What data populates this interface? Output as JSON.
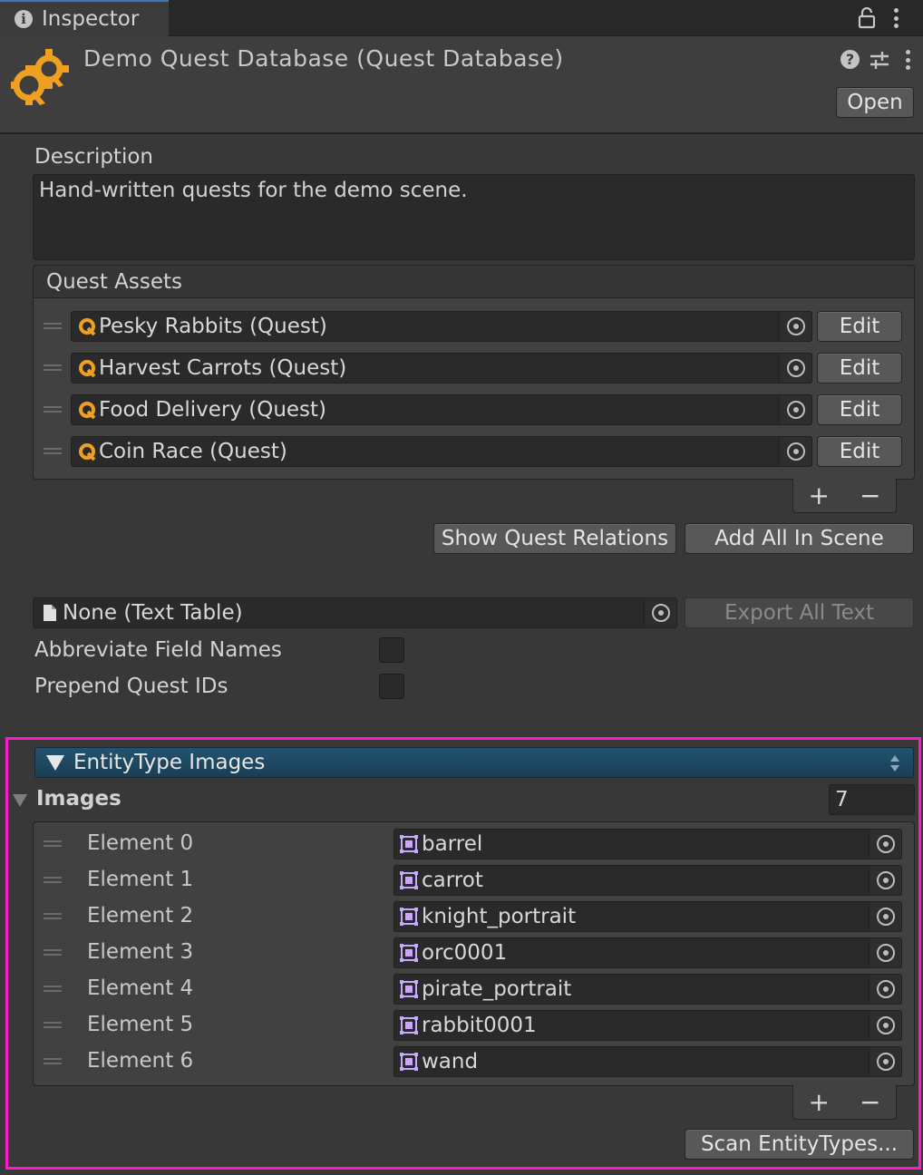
{
  "tab": {
    "title": "Inspector"
  },
  "header": {
    "title": "Demo Quest Database (Quest Database)",
    "open_label": "Open"
  },
  "description": {
    "label": "Description",
    "value": "Hand-written quests for the demo scene."
  },
  "quest_assets": {
    "header": "Quest Assets",
    "items": [
      {
        "name": "Pesky Rabbits (Quest)",
        "edit_label": "Edit"
      },
      {
        "name": "Harvest Carrots (Quest)",
        "edit_label": "Edit"
      },
      {
        "name": "Food Delivery (Quest)",
        "edit_label": "Edit"
      },
      {
        "name": "Coin Race (Quest)",
        "edit_label": "Edit"
      }
    ],
    "add_label": "+",
    "remove_label": "−"
  },
  "actions": {
    "show_relations": "Show Quest Relations",
    "add_all": "Add All In Scene"
  },
  "text_table": {
    "value": "None (Text Table)",
    "export_label": "Export All Text"
  },
  "options": {
    "abbreviate_label": "Abbreviate Field Names",
    "prepend_label": "Prepend Quest IDs"
  },
  "entity_images": {
    "section_title": "EntityType Images",
    "images_label": "Images",
    "count": "7",
    "elements": [
      {
        "label": "Element 0",
        "value": "barrel"
      },
      {
        "label": "Element 1",
        "value": "carrot"
      },
      {
        "label": "Element 2",
        "value": "knight_portrait"
      },
      {
        "label": "Element 3",
        "value": "orc0001"
      },
      {
        "label": "Element 4",
        "value": "pirate_portrait"
      },
      {
        "label": "Element 5",
        "value": "rabbit0001"
      },
      {
        "label": "Element 6",
        "value": "wand"
      }
    ],
    "add_label": "+",
    "remove_label": "−",
    "scan_label": "Scan EntityTypes..."
  },
  "colors": {
    "background": "#383838",
    "accent_tab": "#3a79bb",
    "highlight": "#ff19cc",
    "quest_icon": "#f0a020",
    "section_bar": "#23536f"
  }
}
